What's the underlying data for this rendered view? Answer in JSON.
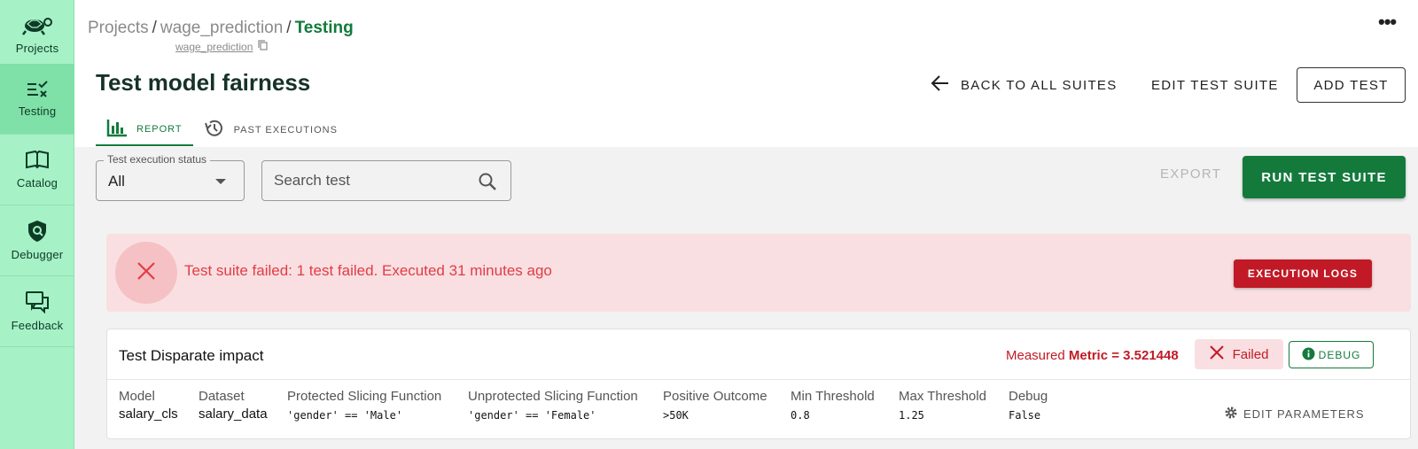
{
  "sidebar": {
    "items": [
      {
        "label": "Projects",
        "icon": "turtle-logo-icon"
      },
      {
        "label": "Testing",
        "icon": "checklist-icon",
        "active": true
      },
      {
        "label": "Catalog",
        "icon": "book-icon"
      },
      {
        "label": "Debugger",
        "icon": "shield-search-icon"
      },
      {
        "label": "Feedback",
        "icon": "chat-bubbles-icon"
      }
    ]
  },
  "header": {
    "breadcrumb": [
      "Projects",
      "wage_prediction",
      "Testing"
    ],
    "breadcrumb_sep": "/",
    "project_key": "wage_prediction",
    "more_label": "•••"
  },
  "page": {
    "title": "Test model fairness",
    "back_label": "BACK TO ALL SUITES",
    "edit_label": "EDIT TEST SUITE",
    "add_label": "ADD TEST"
  },
  "tabs": [
    {
      "label": "REPORT",
      "icon": "bar-chart-icon",
      "active": true
    },
    {
      "label": "PAST EXECUTIONS",
      "icon": "history-icon"
    }
  ],
  "toolbar": {
    "status_legend": "Test execution status",
    "status_value": "All",
    "search_placeholder": "Search test",
    "export_label": "EXPORT",
    "run_label": "RUN TEST SUITE"
  },
  "alert": {
    "message": "Test suite failed: 1 test failed. Executed 31 minutes ago",
    "logs_label": "EXECUTION LOGS"
  },
  "test": {
    "title": "Test Disparate impact",
    "measured_prefix": "Measured",
    "measured_metric": "Metric = 3.521448",
    "status": "Failed",
    "debug_label": "DEBUG",
    "edit_label": "EDIT PARAMETERS",
    "params": [
      {
        "header": "Model",
        "value": "salary_cls",
        "mono": false
      },
      {
        "header": "Dataset",
        "value": "salary_data",
        "mono": false
      },
      {
        "header": "Protected Slicing Function",
        "value": "'gender' == 'Male'",
        "mono": true
      },
      {
        "header": "Unprotected Slicing Function",
        "value": "'gender' == 'Female'",
        "mono": true
      },
      {
        "header": "Positive Outcome",
        "value": ">50K",
        "mono": true
      },
      {
        "header": "Min Threshold",
        "value": "0.8",
        "mono": true
      },
      {
        "header": "Max Threshold",
        "value": "1.25",
        "mono": true
      },
      {
        "header": "Debug",
        "value": "False",
        "mono": true
      }
    ]
  },
  "colors": {
    "brand_green": "#137a3c",
    "sidebar_bg": "#a6f1c6",
    "error_red": "#c11a26",
    "alert_bg": "#f9dfe1"
  }
}
